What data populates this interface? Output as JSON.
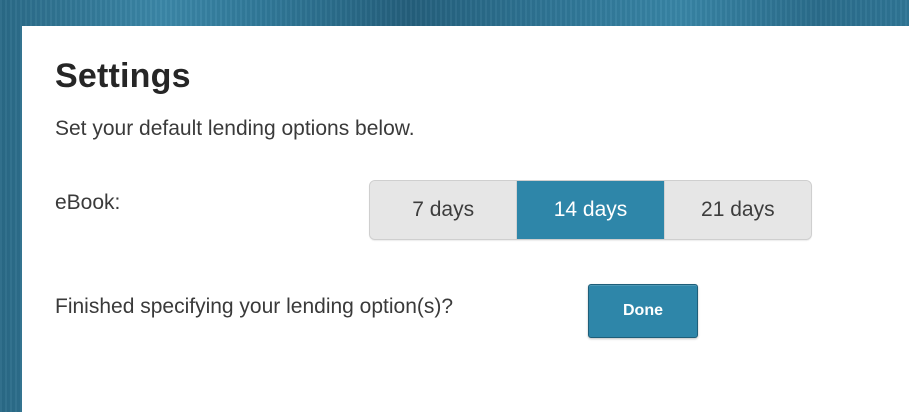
{
  "settings": {
    "title": "Settings",
    "subtitle": "Set your default lending options below.",
    "ebook_label": "eBook:",
    "lending_options": [
      {
        "label": "7 days",
        "selected": false
      },
      {
        "label": "14 days",
        "selected": true
      },
      {
        "label": "21 days",
        "selected": false
      }
    ],
    "finished_prompt": "Finished specifying your lending option(s)?",
    "done_label": "Done"
  },
  "colors": {
    "accent": "#2e86a9",
    "unselected_segment": "#e6e6e6",
    "background_frame": "#2c6f8c"
  }
}
